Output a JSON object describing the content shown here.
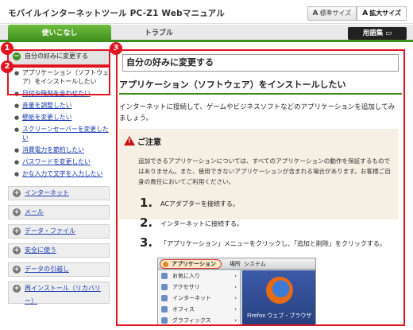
{
  "header": {
    "title": "モバイルインターネットツール  PC-Z1  Webマニュアル",
    "size_standard": "標準サイズ",
    "size_large": "拡大サイズ"
  },
  "tabs": {
    "active": "使いこなし",
    "other": "トラブル",
    "glossary": "用語集"
  },
  "sidebar": {
    "section_title": "自分の好みに変更する",
    "current_item": "アプリケーション（ソフトウェア）をインストールしたい",
    "sub_items": [
      "日付や時刻を合わせたい",
      "音量を調整したい",
      "壁紙を変更したい",
      "スクリーンセーバーを変更したい",
      "消費電力を節約したい",
      "パスワードを変更したい",
      "かな入力で文字を入力したい"
    ],
    "categories": [
      "インターネット",
      "メール",
      "データ・ファイル",
      "安全に使う",
      "データの引越し",
      "再インストール（リカバリー）"
    ]
  },
  "badges": [
    "1",
    "2",
    "3"
  ],
  "main": {
    "section_title": "自分の好みに変更する",
    "page_title": "アプリケーション（ソフトウェア）をインストールしたい",
    "intro": "インターネットに接続して、ゲームやビジネスソフトなどのアプリケーションを追加してみましょう。",
    "caution_title": "ご注意",
    "caution_body": "追加できるアプリケーションについては、すべてのアプリケーションの動作を保証するものではありません。また、使用できないアプリケーションが含まれる場合があります。お客様ご自身の責任においてご利用ください。",
    "steps": [
      {
        "num": "1.",
        "text": "ACアダプターを接続する。"
      },
      {
        "num": "2.",
        "text": "インターネットに接続する。"
      },
      {
        "num": "3.",
        "text": "「アプリケーション」メニューをクリックし、「追加と削除」をクリックする。"
      }
    ]
  },
  "screenshot": {
    "app_menu": "アプリケーション",
    "menu_2": "場所",
    "menu_3": "システム",
    "items": [
      "お気に入り",
      "アクセサリ",
      "インターネット",
      "オフィス",
      "グラフィックス"
    ],
    "desktop_label": "Firefox ウェブ・ブラウザ"
  },
  "colors": {
    "accent_green": "#3f8f1f",
    "highlight_red": "#e0141f",
    "caution_bg": "#f6efe4"
  }
}
